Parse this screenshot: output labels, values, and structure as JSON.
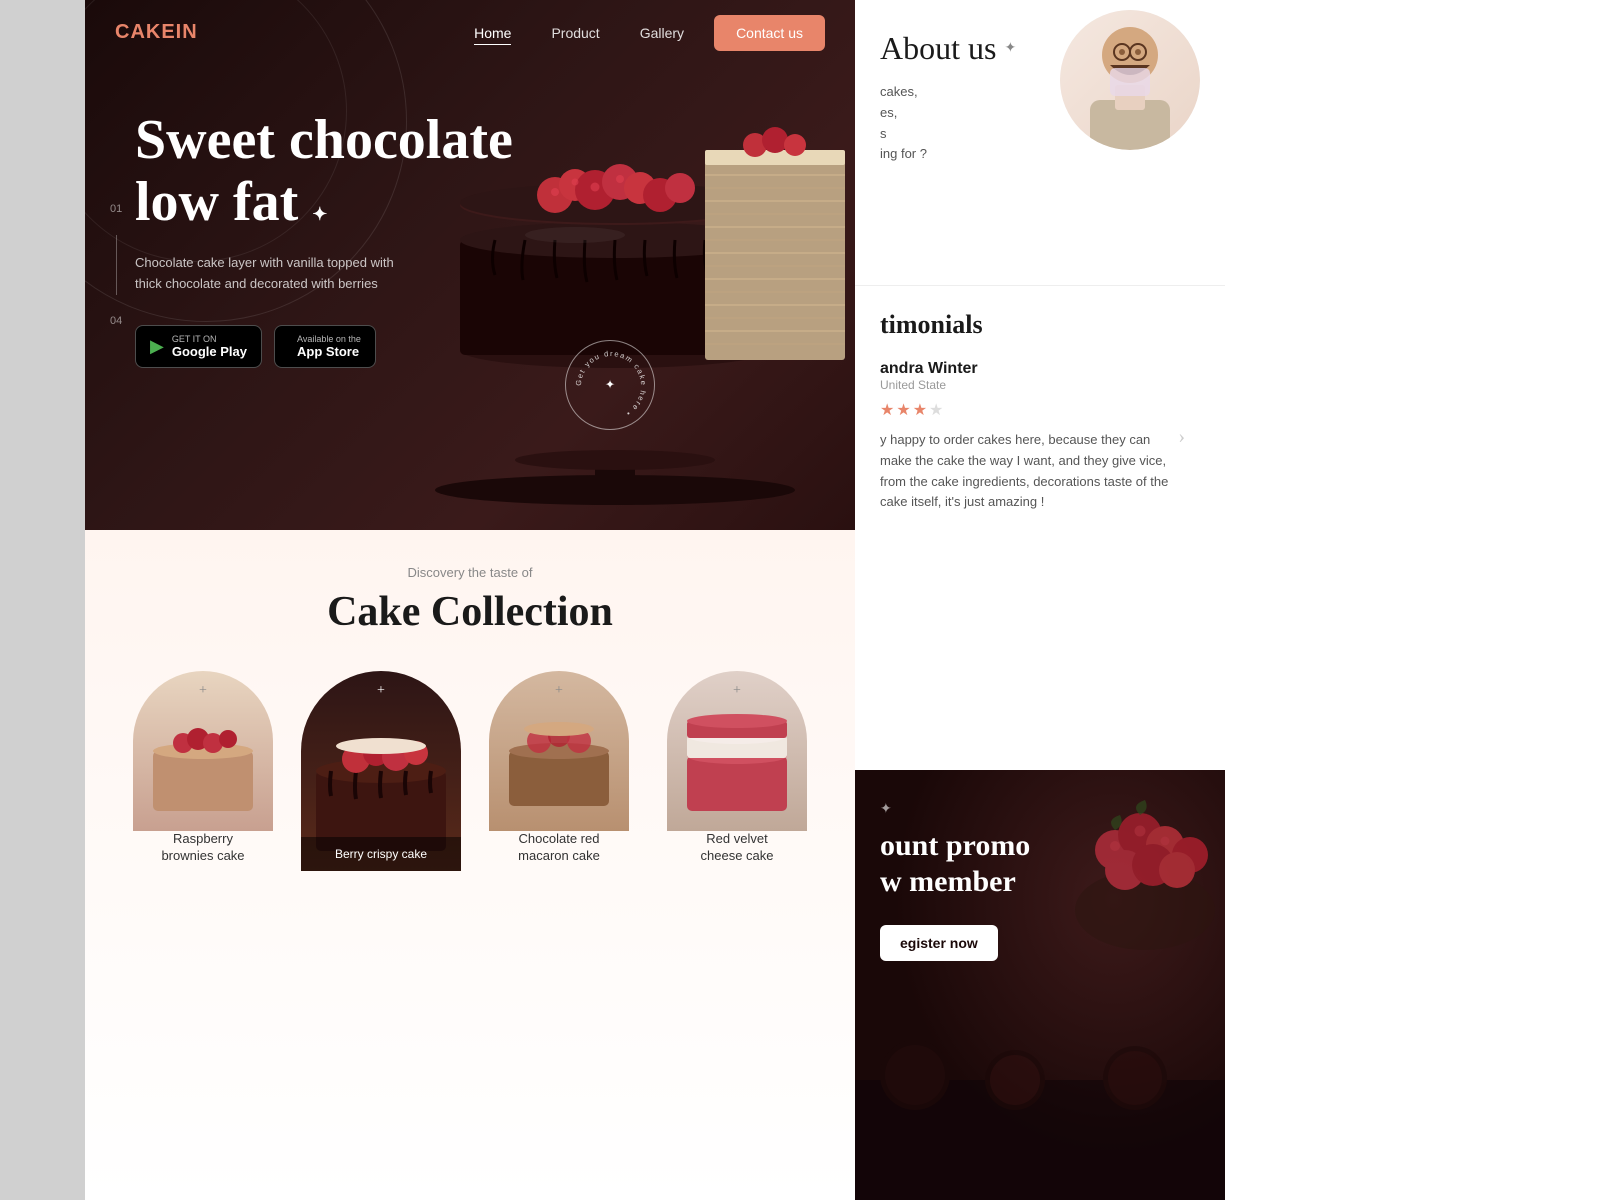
{
  "site": {
    "logo": "CAKE",
    "logo_accent": "IN",
    "tagline": "Discovery the taste of",
    "collection_title": "Cake Collection"
  },
  "navbar": {
    "links": [
      {
        "label": "Home",
        "active": true
      },
      {
        "label": "Product",
        "active": false
      },
      {
        "label": "Gallery",
        "active": false
      }
    ],
    "contact_btn": "Contact us"
  },
  "hero": {
    "slide_num_top": "01",
    "slide_num_bottom": "04",
    "title_line1": "Sweet chocolate",
    "title_line2": "low fat",
    "title_star": "✦",
    "description": "Chocolate cake layer with vanilla topped with thick chocolate and decorated with berries",
    "dream_text": "Get you dream cake here",
    "dream_star": "✦"
  },
  "app_buttons": [
    {
      "small": "GET IT ON",
      "large": "Google Play",
      "icon": "▶"
    },
    {
      "small": "Available on the",
      "large": "App Store",
      "icon": ""
    }
  ],
  "about": {
    "title": "About us",
    "arrow": "✦",
    "description1": "cakes,",
    "description2": "es,",
    "description3": "s",
    "description4": "ing for ?"
  },
  "testimonials": {
    "section_title": "timonials",
    "reviewer": {
      "name": "andra Winter",
      "country": "United State",
      "stars": 3,
      "max_stars": 5,
      "review": "y happy to order cakes here, because they can make the cake the way I want, and they give vice, from the cake ingredients, decorations taste of the cake itself, it's just amazing !"
    }
  },
  "promo": {
    "star": "✦",
    "title_line1": "ount promo",
    "title_line2": "w member",
    "btn_label": "egister now"
  },
  "cake_cards": [
    {
      "id": 1,
      "name": "Raspberry\nbrownies cake",
      "featured": false,
      "plus": "+"
    },
    {
      "id": 2,
      "name": "Berry crispy cake",
      "featured": true,
      "plus": "+"
    },
    {
      "id": 3,
      "name": "Chocolate red\nmacaron cake",
      "featured": false,
      "plus": "+"
    },
    {
      "id": 4,
      "name": "Red velvet\ncheese cake",
      "featured": false,
      "plus": "+"
    }
  ],
  "colors": {
    "accent": "#e8856a",
    "dark": "#1a0808",
    "hero_bg": "#2d1010",
    "light_bg": "#fff5f0"
  }
}
